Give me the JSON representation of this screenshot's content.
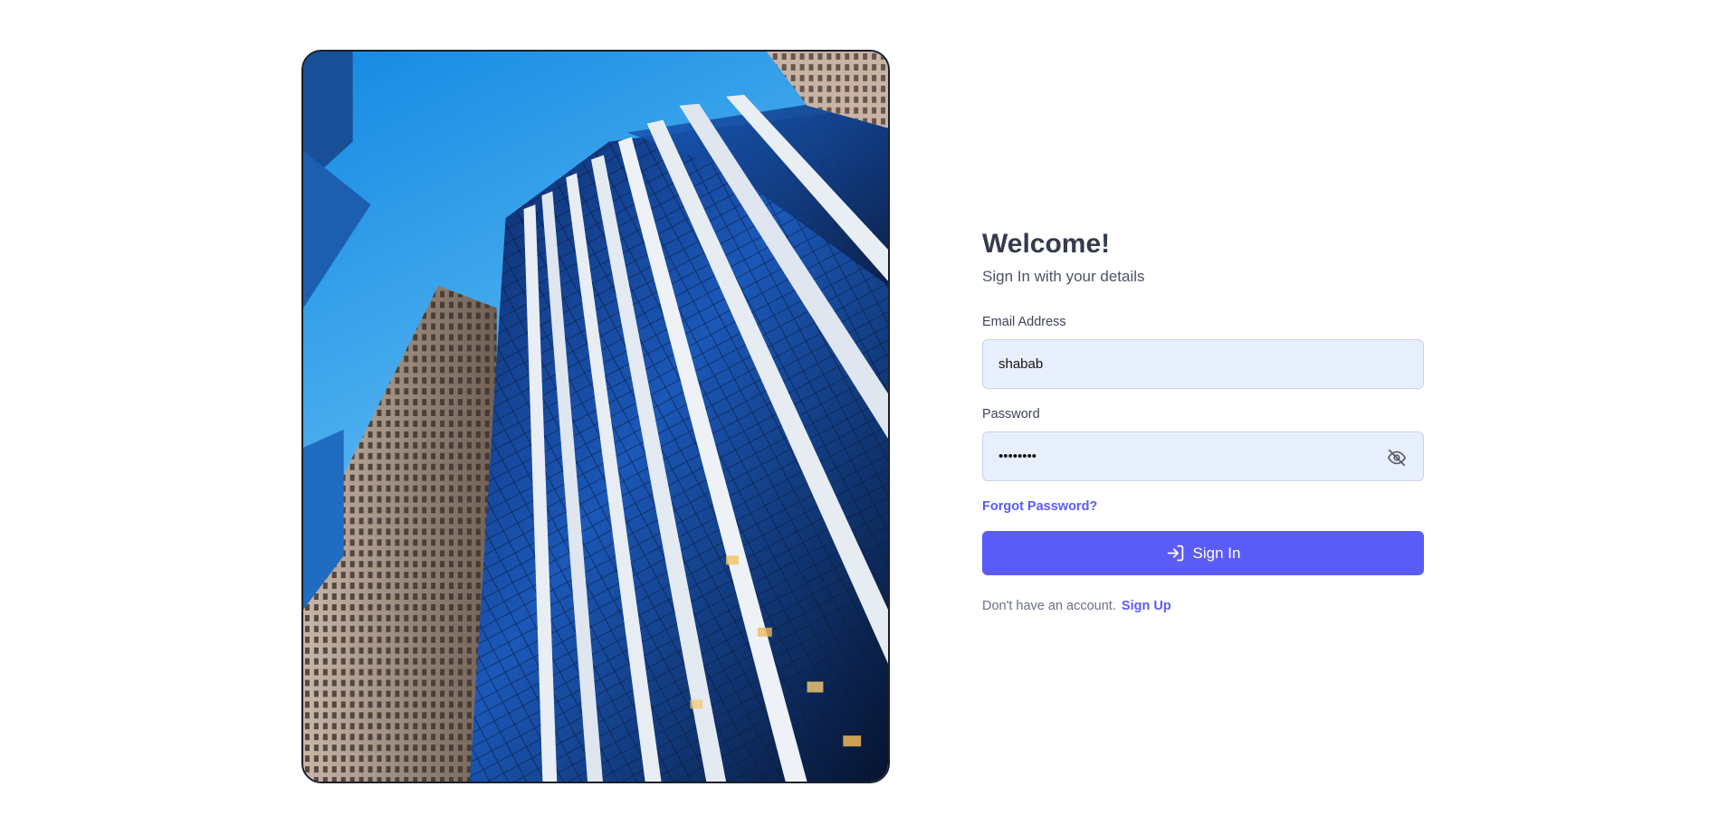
{
  "hero": {
    "icon": "skyscrapers-photo"
  },
  "login": {
    "title": "Welcome!",
    "subtitle": "Sign In with your details",
    "email_label": "Email Address",
    "email_value": "shabab",
    "password_label": "Password",
    "password_value": "password",
    "password_toggle_icon": "eye-off-icon",
    "forgot_label": "Forgot Password?",
    "submit_icon": "sign-in-icon",
    "submit_label": "Sign In",
    "no_account_text": "Don't have an account.",
    "signup_label": "Sign Up"
  },
  "colors": {
    "accent": "#5b5cf8",
    "field_bg": "#e8effd",
    "title": "#353b4c"
  }
}
